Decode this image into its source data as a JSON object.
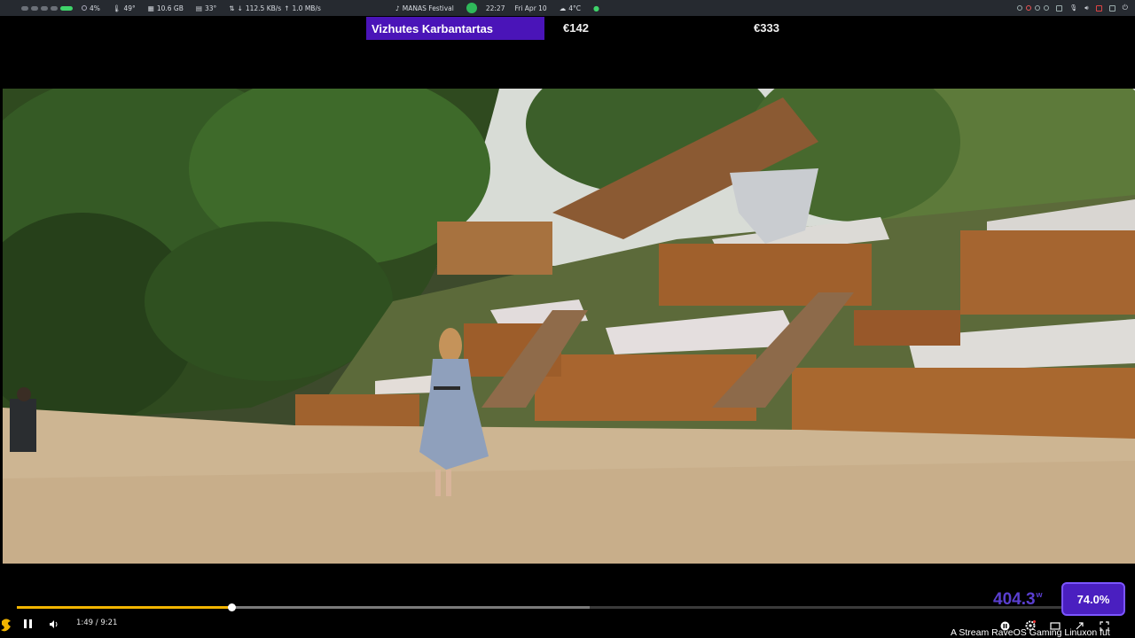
{
  "topbar": {
    "cpu": "4%",
    "temp": "49°",
    "memory": "10.6 GB",
    "gpu_temp": "33°",
    "net_down": "112.5 KB/s",
    "net_up": "1.0 MB/s",
    "media_title": "MANAS Festival",
    "time": "22:27",
    "date": "Fri Apr 10",
    "weather": "4°C"
  },
  "overlay": {
    "name": "Vizhutes Karbantartas",
    "price_1": "€142",
    "price_2": "€333"
  },
  "player": {
    "time_display": "1:49 / 9:21",
    "progress_fraction": 0.194,
    "buffered_fraction": 0.518,
    "power_value": "404.3",
    "power_unit": "w",
    "percent_badge": "74.0%",
    "ticker": "A Stream RaveOS Gaming Linuxon fut"
  },
  "colors": {
    "progress": "#f2b400",
    "badge": "#4a1fc0",
    "overlay_name_bg": "#4a14b8"
  }
}
